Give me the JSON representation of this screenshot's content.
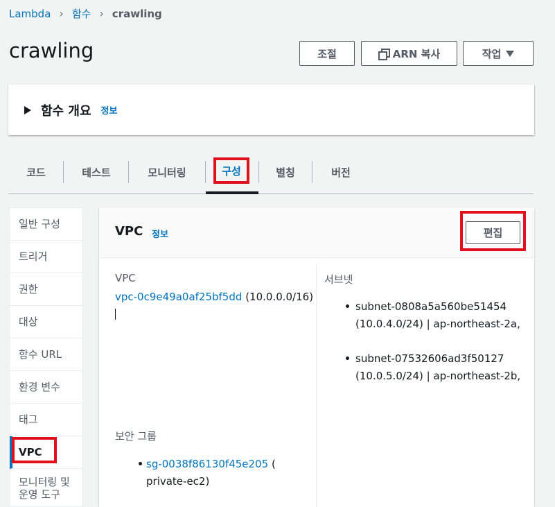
{
  "breadcrumb": {
    "root": "Lambda",
    "level2": "함수",
    "current": "crawling"
  },
  "header": {
    "title": "crawling",
    "throttle_label": "조절",
    "copy_arn_label": "ARN 복사",
    "actions_label": "작업"
  },
  "overview": {
    "title": "함수 개요",
    "info": "정보"
  },
  "tabs": [
    "코드",
    "테스트",
    "모니터링",
    "구성",
    "별칭",
    "버전"
  ],
  "active_tab": "구성",
  "sidenav": {
    "items": [
      "일반 구성",
      "트리거",
      "권한",
      "대상",
      "함수 URL",
      "환경 변수",
      "태그",
      "VPC",
      "모니터링 및 운영 도구"
    ],
    "active": "VPC"
  },
  "vpc_panel": {
    "title": "VPC",
    "info": "정보",
    "edit_label": "편집",
    "vpc_label": "VPC",
    "vpc_id": "vpc-0c9e49a0af25bf5dd",
    "vpc_cidr": "(10.0.0.0/16)",
    "vpc_cursor": "|",
    "subnets_label": "서브넷",
    "subnets": [
      {
        "id": "subnet-0808a5a560be51454",
        "detail": "(10.0.4.0/24) | ap-northeast-2a,"
      },
      {
        "id": "subnet-07532606ad3f50127",
        "detail": "(10.0.5.0/24) | ap-northeast-2b,"
      }
    ],
    "sg_label": "보안 그룹",
    "security_groups": [
      {
        "id": "sg-0038f86130f45e205",
        "paren_open": "(",
        "name": "private-ec2)"
      }
    ]
  },
  "colors": {
    "link": "#0073bb",
    "highlight": "#e0101d",
    "text": "#16191f",
    "muted": "#545b64",
    "background": "#f2f3f3"
  }
}
